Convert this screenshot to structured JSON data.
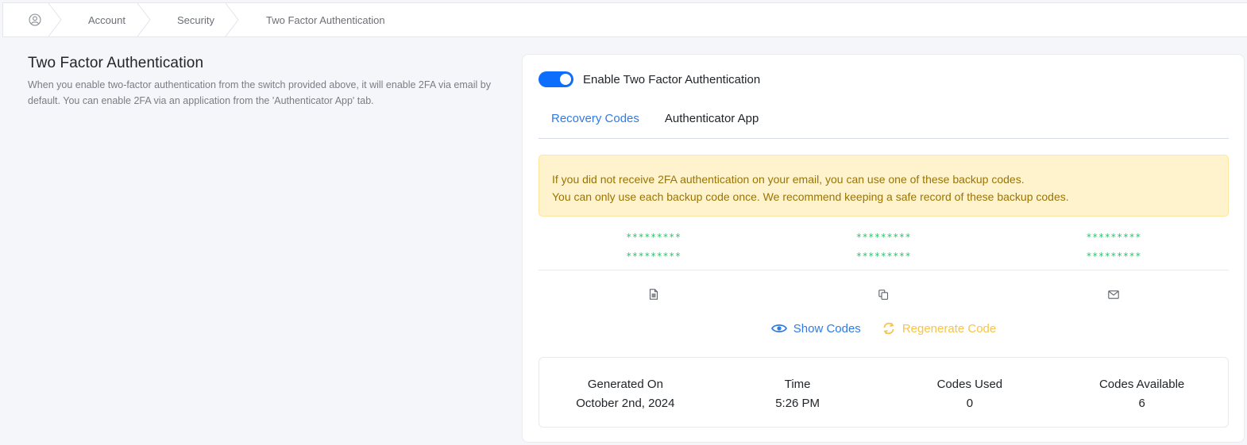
{
  "breadcrumb": {
    "home_icon": "user-circle-icon",
    "items": [
      "Account",
      "Security",
      "Two Factor Authentication"
    ]
  },
  "intro": {
    "title": "Two Factor Authentication",
    "description": "When you enable two-factor authentication from the switch provided above, it will enable 2FA via email by default. You can enable 2FA via an application from the 'Authenticator App' tab."
  },
  "card": {
    "toggle": {
      "label": "Enable Two Factor Authentication",
      "enabled": true
    },
    "tabs": [
      {
        "label": "Recovery Codes",
        "active": true
      },
      {
        "label": "Authenticator App",
        "active": false
      }
    ],
    "alert": {
      "line1": "If you did not receive 2FA authentication on your email, you can use one of these backup codes.",
      "line2": "You can only use each backup code once. We recommend keeping a safe record of these backup codes."
    },
    "codes": [
      "*********",
      "*********",
      "*********",
      "*********",
      "*********",
      "*********"
    ],
    "code_actions": [
      {
        "icon": "file-icon",
        "name": "download"
      },
      {
        "icon": "copy-icon",
        "name": "copy"
      },
      {
        "icon": "mail-icon",
        "name": "email"
      }
    ],
    "show_codes_label": "Show Codes",
    "regenerate_label": "Regenerate Code",
    "stats": [
      {
        "label": "Generated On",
        "value": "October 2nd, 2024"
      },
      {
        "label": "Time",
        "value": "5:26 PM"
      },
      {
        "label": "Codes Used",
        "value": "0"
      },
      {
        "label": "Codes Available",
        "value": "6"
      }
    ]
  },
  "colors": {
    "primary": "#0d6efd",
    "tab_active": "#2f7be5",
    "code_green": "#24c86b",
    "regenerate": "#f7c34a",
    "alert_bg": "#fff3cd",
    "alert_text": "#997404"
  }
}
